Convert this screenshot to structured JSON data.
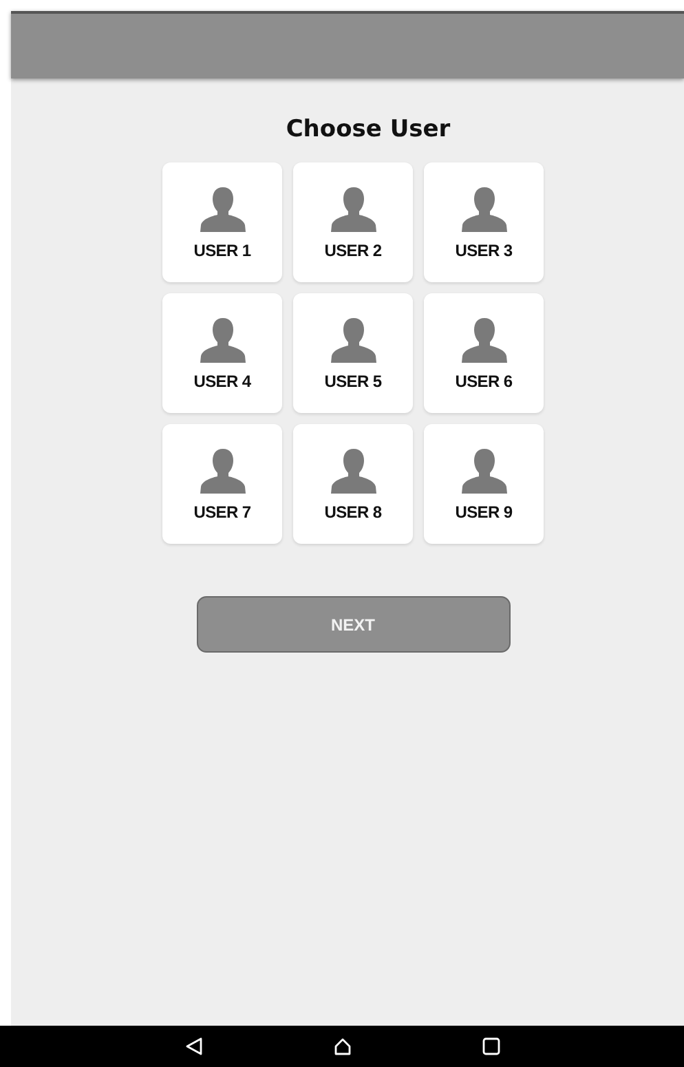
{
  "title": "Choose User",
  "users": [
    {
      "label": "USER 1"
    },
    {
      "label": "USER 2"
    },
    {
      "label": "USER 3"
    },
    {
      "label": "USER 4"
    },
    {
      "label": "USER 5"
    },
    {
      "label": "USER 6"
    },
    {
      "label": "USER 7"
    },
    {
      "label": "USER 8"
    },
    {
      "label": "USER 9"
    }
  ],
  "next_button": {
    "label": "NEXT",
    "disabled": true
  }
}
